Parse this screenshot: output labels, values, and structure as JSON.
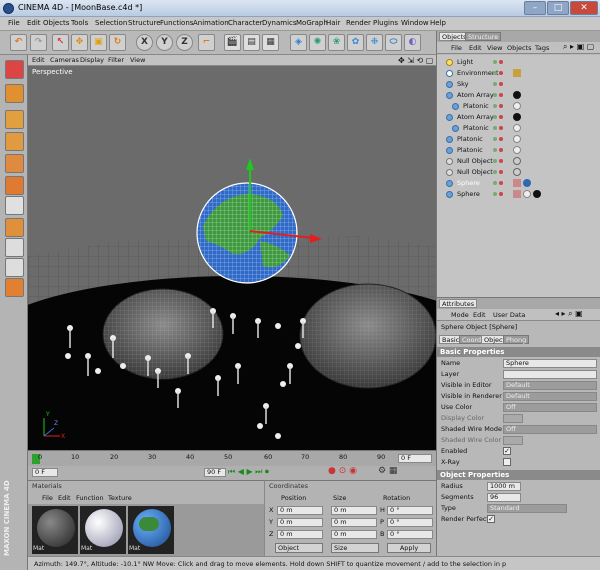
{
  "window": {
    "title": "CINEMA 4D - [MoonBase.c4d *]"
  },
  "menu": [
    "File",
    "Edit",
    "Objects",
    "Tools",
    "Selection",
    "Structure",
    "Functions",
    "Animation",
    "Character",
    "Dynamics",
    "MoGraph",
    "Hair",
    "Render",
    "Plugins",
    "Window",
    "Help"
  ],
  "toolbar": {
    "axis_x": "X",
    "axis_y": "Y",
    "axis_z": "Z"
  },
  "viewport": {
    "menu": [
      "Edit",
      "Cameras",
      "Display",
      "Filter",
      "View"
    ],
    "label": "Perspective",
    "axis_labels": {
      "x": "X",
      "y": "Y",
      "z": "Z"
    }
  },
  "timeline": {
    "ticks": [
      "0",
      "10",
      "20",
      "30",
      "40",
      "50",
      "60",
      "70",
      "80",
      "90"
    ],
    "current_frame": "0 F",
    "start_field": "0 F",
    "end_field": "90 F",
    "end_frame": "0 F"
  },
  "materials": {
    "menu": [
      "File",
      "Edit",
      "Function",
      "Texture"
    ],
    "header": "Materials",
    "items": [
      {
        "label": "Mat"
      },
      {
        "label": "Mat"
      },
      {
        "label": "Mat"
      }
    ]
  },
  "coordinates": {
    "header": "Coordinates",
    "col_position": "Position",
    "col_size": "Size",
    "col_rotation": "Rotation",
    "rows": [
      {
        "axis": "X",
        "pos": "0 m",
        "size": "0 m",
        "rot_axis": "H",
        "rot": "0 °"
      },
      {
        "axis": "Y",
        "pos": "0 m",
        "size": "0 m",
        "rot_axis": "P",
        "rot": "0 °"
      },
      {
        "axis": "Z",
        "pos": "0 m",
        "size": "0 m",
        "rot_axis": "B",
        "rot": "0 °"
      }
    ],
    "mode_select": "Object",
    "size_select": "Size",
    "apply": "Apply"
  },
  "status": {
    "text": "Azimuth: 149.7°, Altitude: -10.1°  NW   Move: Click and drag to move elements. Hold down SHIFT to quantize movement / add to the selection in p"
  },
  "object_manager": {
    "tabs": [
      "Objects",
      "Structure"
    ],
    "menu": [
      "File",
      "Edit",
      "View",
      "Objects",
      "Tags"
    ],
    "rows": [
      {
        "name": "Light"
      },
      {
        "name": "Environment"
      },
      {
        "name": "Sky"
      },
      {
        "name": "Atom Array"
      },
      {
        "name": "Platonic"
      },
      {
        "name": "Atom Array"
      },
      {
        "name": "Platonic"
      },
      {
        "name": "Platonic"
      },
      {
        "name": "Platonic"
      },
      {
        "name": "Null Object"
      },
      {
        "name": "Null Object"
      },
      {
        "name": "Sphere"
      },
      {
        "name": "Sphere"
      }
    ]
  },
  "attributes": {
    "tab": "Attributes",
    "menu": [
      "Mode",
      "Edit",
      "User Data"
    ],
    "object_title": "Sphere Object [Sphere]",
    "tabs": [
      "Basic",
      "Coord.",
      "Object",
      "Phong"
    ],
    "basic_header": "Basic Properties",
    "basic": [
      {
        "label": "Name",
        "value": "Sphere"
      },
      {
        "label": "Layer",
        "value": ""
      },
      {
        "label": "Visible in Editor",
        "value": "Default"
      },
      {
        "label": "Visible in Renderer",
        "value": "Default"
      },
      {
        "label": "Use Color",
        "value": "Off"
      },
      {
        "label": "Display Color",
        "value": ""
      },
      {
        "label": "Shaded Wire Mode",
        "value": "Off"
      },
      {
        "label": "Shaded Wire Color",
        "value": ""
      },
      {
        "label": "Enabled",
        "value": "✓"
      },
      {
        "label": "X-Ray",
        "value": ""
      }
    ],
    "object_header": "Object Properties",
    "object": [
      {
        "label": "Radius",
        "value": "1000 m"
      },
      {
        "label": "Segments",
        "value": "96"
      },
      {
        "label": "Type",
        "value": "Standard"
      },
      {
        "label": "Render Perfect",
        "value": "✓"
      }
    ]
  },
  "branding": "MAXON CINEMA 4D"
}
